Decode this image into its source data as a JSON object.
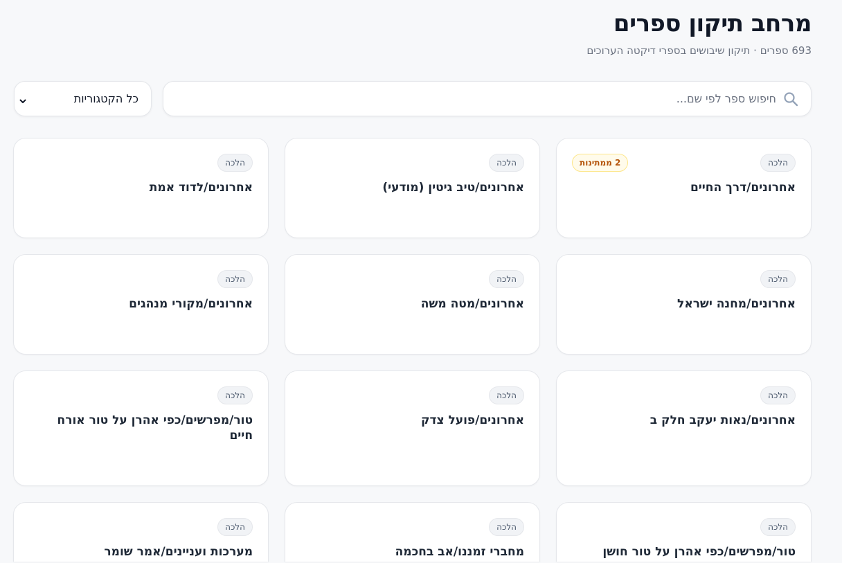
{
  "header": {
    "title": "מרחב תיקון ספרים",
    "subtitle": "693 ספרים · תיקון שיבושים בספרי דיקטה הערוכים"
  },
  "search": {
    "placeholder": "חיפוש ספר לפי שם...",
    "value": ""
  },
  "filter": {
    "selected": "כל הקטגוריות"
  },
  "books": [
    {
      "title": "אחרונים/דרך החיים",
      "category": "הלכה",
      "pending": "2 ממתינות"
    },
    {
      "title": "אחרונים/טיב גיטין (מודעי)",
      "category": "הלכה"
    },
    {
      "title": "אחרונים/לדוד אמת",
      "category": "הלכה"
    },
    {
      "title": "אחרונים/מחנה ישראל",
      "category": "הלכה"
    },
    {
      "title": "אחרונים/מטה משה",
      "category": "הלכה"
    },
    {
      "title": "אחרונים/מקורי מנהגים",
      "category": "הלכה"
    },
    {
      "title": "אחרונים/נאות יעקב חלק ב",
      "category": "הלכה"
    },
    {
      "title": "אחרונים/פועל צדק",
      "category": "הלכה"
    },
    {
      "title": "טור/מפרשים/כפי אהרן על טור אורח חיים",
      "category": "הלכה"
    },
    {
      "title": "טור/מפרשים/כפי אהרן על טור חושן",
      "category": "הלכה"
    },
    {
      "title": "מחברי זמננו/אב בחכמה",
      "category": "הלכה"
    },
    {
      "title": "מערכות ועניינים/אמר שומר",
      "category": "הלכה"
    }
  ]
}
